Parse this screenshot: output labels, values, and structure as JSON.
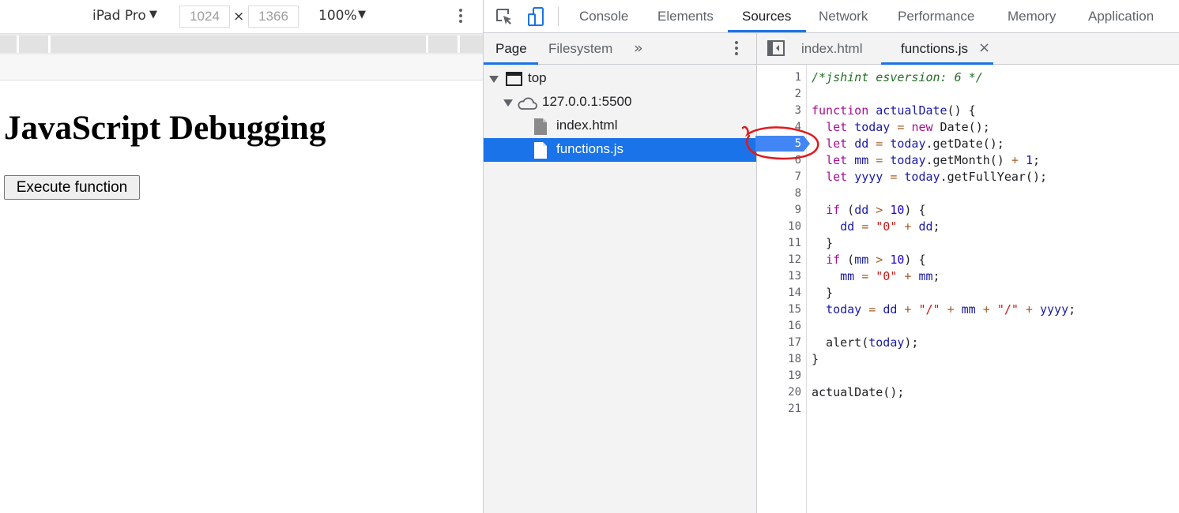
{
  "device_toolbar": {
    "device_name": "iPad Pro",
    "width": "1024",
    "height": "1366",
    "times": "×",
    "zoom": "100%",
    "arrow": "▼"
  },
  "page": {
    "heading": "JavaScript Debugging",
    "button_label": "Execute function"
  },
  "devtools": {
    "main_tabs": [
      "Console",
      "Elements",
      "Sources",
      "Network",
      "Performance",
      "Memory",
      "Application"
    ],
    "active_main_tab": "Sources",
    "navigator": {
      "tabs": [
        "Page",
        "Filesystem"
      ],
      "more": "»",
      "tree": [
        {
          "label": "top",
          "level": 0
        },
        {
          "label": "127.0.0.1:5500",
          "level": 1
        },
        {
          "label": "index.html",
          "level": 2
        },
        {
          "label": "functions.js",
          "level": 2,
          "selected": true
        }
      ]
    },
    "editor": {
      "tabs": [
        "index.html",
        "functions.js"
      ],
      "active_tab": "functions.js",
      "close": "×",
      "breakpoint_line": 5,
      "lines": [
        [
          [
            "/*jshint esversion: 6 */",
            "comment"
          ]
        ],
        [],
        [
          [
            "function",
            "kw"
          ],
          [
            " ",
            ""
          ],
          [
            "actualDate",
            "def"
          ],
          [
            "() {",
            ""
          ]
        ],
        [
          [
            "  ",
            ""
          ],
          [
            "let",
            "kw"
          ],
          [
            " ",
            ""
          ],
          [
            "today",
            "var"
          ],
          [
            " = ",
            "op"
          ],
          [
            "new",
            "kw"
          ],
          [
            " Date();",
            ""
          ]
        ],
        [
          [
            "  ",
            ""
          ],
          [
            "let",
            "kw"
          ],
          [
            " ",
            ""
          ],
          [
            "dd",
            "var"
          ],
          [
            " = ",
            "op"
          ],
          [
            "today",
            "var"
          ],
          [
            ".getDate();",
            ""
          ]
        ],
        [
          [
            "  ",
            ""
          ],
          [
            "let",
            "kw"
          ],
          [
            " ",
            ""
          ],
          [
            "mm",
            "var"
          ],
          [
            " = ",
            "op"
          ],
          [
            "today",
            "var"
          ],
          [
            ".getMonth() ",
            ""
          ],
          [
            "+",
            "op"
          ],
          [
            " ",
            ""
          ],
          [
            "1",
            "num"
          ],
          [
            ";",
            ""
          ]
        ],
        [
          [
            "  ",
            ""
          ],
          [
            "let",
            "kw"
          ],
          [
            " ",
            ""
          ],
          [
            "yyyy",
            "var"
          ],
          [
            " = ",
            "op"
          ],
          [
            "today",
            "var"
          ],
          [
            ".getFullYear();",
            ""
          ]
        ],
        [],
        [
          [
            "  ",
            ""
          ],
          [
            "if",
            "kw"
          ],
          [
            " (",
            ""
          ],
          [
            "dd",
            "var"
          ],
          [
            " > ",
            "op"
          ],
          [
            "10",
            "num"
          ],
          [
            ") {",
            ""
          ]
        ],
        [
          [
            "    ",
            ""
          ],
          [
            "dd",
            "var"
          ],
          [
            " = ",
            "op"
          ],
          [
            "\"0\"",
            "str"
          ],
          [
            " + ",
            "op"
          ],
          [
            "dd",
            "var"
          ],
          [
            ";",
            ""
          ]
        ],
        [
          [
            "  }",
            ""
          ]
        ],
        [
          [
            "  ",
            ""
          ],
          [
            "if",
            "kw"
          ],
          [
            " (",
            ""
          ],
          [
            "mm",
            "var"
          ],
          [
            " > ",
            "op"
          ],
          [
            "10",
            "num"
          ],
          [
            ") {",
            ""
          ]
        ],
        [
          [
            "    ",
            ""
          ],
          [
            "mm",
            "var"
          ],
          [
            " = ",
            "op"
          ],
          [
            "\"0\"",
            "str"
          ],
          [
            " + ",
            "op"
          ],
          [
            "mm",
            "var"
          ],
          [
            ";",
            ""
          ]
        ],
        [
          [
            "  }",
            ""
          ]
        ],
        [
          [
            "  ",
            ""
          ],
          [
            "today",
            "var"
          ],
          [
            " = ",
            "op"
          ],
          [
            "dd",
            "var"
          ],
          [
            " + ",
            "op"
          ],
          [
            "\"/\"",
            "str"
          ],
          [
            " + ",
            "op"
          ],
          [
            "mm",
            "var"
          ],
          [
            " + ",
            "op"
          ],
          [
            "\"/\"",
            "str"
          ],
          [
            " + ",
            "op"
          ],
          [
            "yyyy",
            "var"
          ],
          [
            ";",
            ""
          ]
        ],
        [],
        [
          [
            "  alert(",
            ""
          ],
          [
            "today",
            "var"
          ],
          [
            ");",
            ""
          ]
        ],
        [
          [
            "}",
            ""
          ]
        ],
        [],
        [
          [
            "actualDate();",
            ""
          ]
        ],
        []
      ]
    }
  },
  "colors": {
    "accent": "#1a73e8",
    "breakpoint": "#4285f4",
    "annotation": "#e0191b",
    "comment": "#236e25",
    "keyword": "#aa0d91",
    "variable": "#1a1aa6",
    "string": "#c41a16",
    "operator": "#a45d2b",
    "number": "#1c00cf"
  }
}
